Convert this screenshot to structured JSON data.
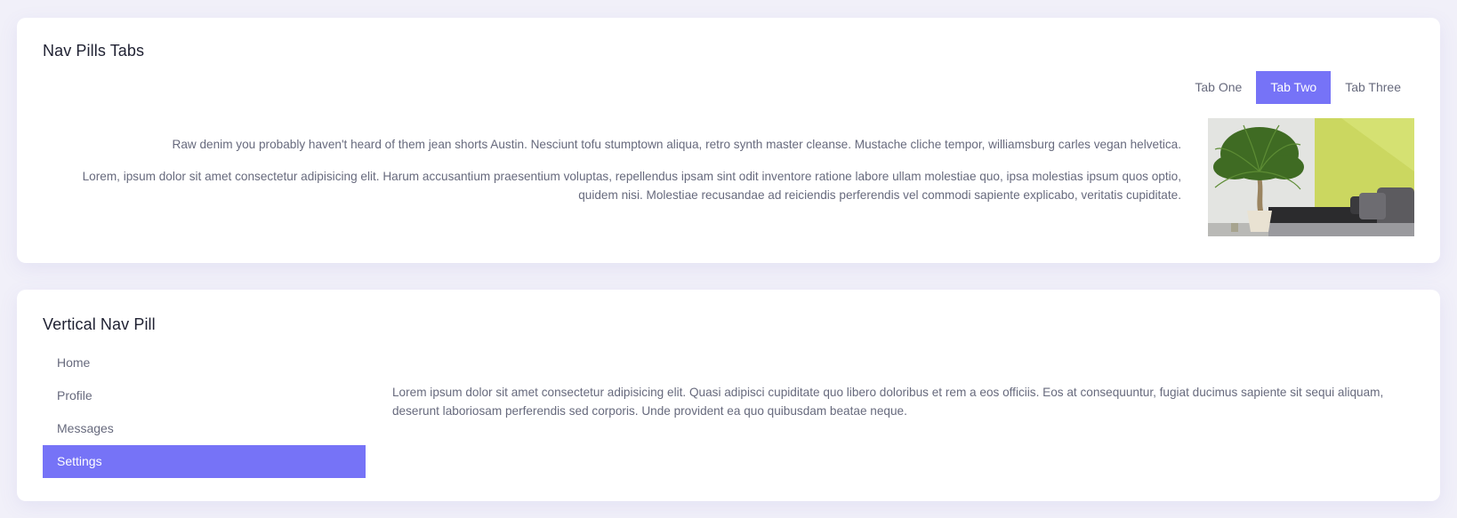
{
  "nav_pills_card": {
    "title": "Nav Pills Tabs",
    "tabs": [
      {
        "label": "Tab One",
        "active": false
      },
      {
        "label": "Tab Two",
        "active": true
      },
      {
        "label": "Tab Three",
        "active": false
      }
    ],
    "paragraphs": [
      "Raw denim you probably haven't heard of them jean shorts Austin. Nesciunt tofu stumptown aliqua, retro synth master cleanse. Mustache cliche tempor, williamsburg carles vegan helvetica.",
      "Lorem, ipsum dolor sit amet consectetur adipisicing elit. Harum accusantium praesentium voluptas, repellendus ipsam sint odit inventore ratione labore ullam molestiae quo, ipsa molestias ipsum quos optio, quidem nisi. Molestiae recusandae ad reiciendis perferendis vel commodi sapiente explicabo, veritatis cupiditate."
    ]
  },
  "vertical_nav_card": {
    "title": "Vertical Nav Pill",
    "items": [
      {
        "label": "Home",
        "active": false
      },
      {
        "label": "Profile",
        "active": false
      },
      {
        "label": "Messages",
        "active": false
      },
      {
        "label": "Settings",
        "active": true
      }
    ],
    "content": "Lorem ipsum dolor sit amet consectetur adipisicing elit. Quasi adipisci cupiditate quo libero doloribus et rem a eos officiis. Eos at consequuntur, fugiat ducimus sapiente sit sequi aliquam, deserunt laboriosam perferendis sed corporis. Unde provident ea quo quibusdam beatae neque."
  },
  "colors": {
    "accent": "#7673f7",
    "background": "#f1f0f9",
    "card": "#ffffff",
    "title": "#1f2132",
    "text": "#676a7d"
  }
}
